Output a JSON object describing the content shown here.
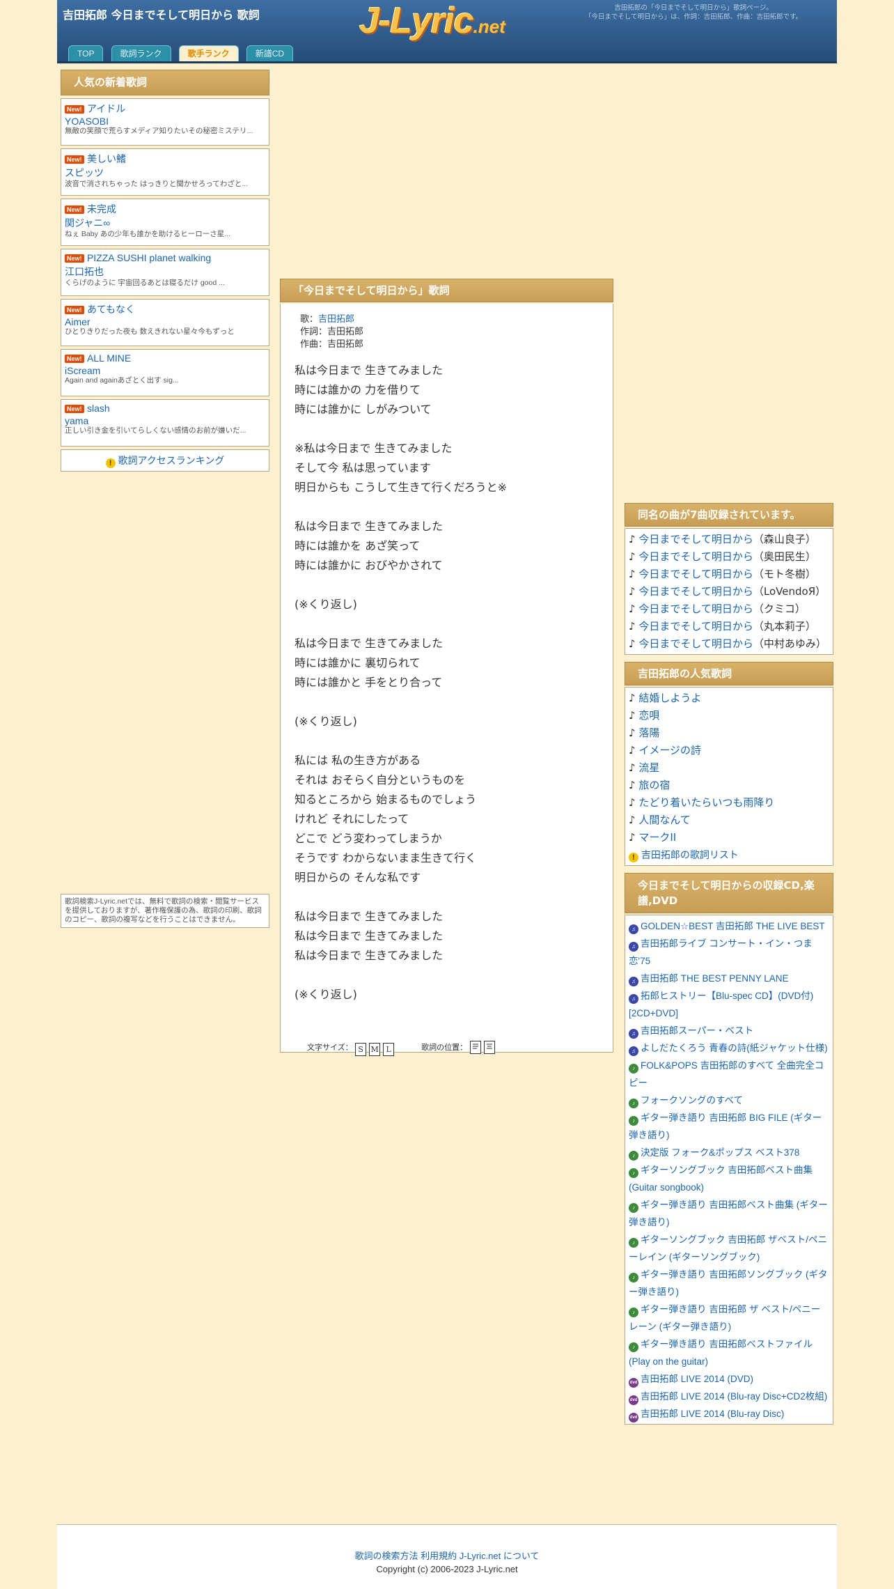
{
  "header": {
    "title": "吉田拓郎 今日までそして明日から 歌詞",
    "logo_main": "J-Lyric",
    "logo_tld": ".net",
    "description_line1": "吉田拓郎の「今日までそして明日から」歌詞ページ。",
    "description_line2": "「今日までそして明日から」は、作詞：吉田拓郎、作曲：吉田拓郎です。"
  },
  "nav": {
    "tabs": [
      {
        "label": "TOP",
        "active": false
      },
      {
        "label": "歌詞ランク",
        "active": false
      },
      {
        "label": "歌手ランク",
        "active": true
      },
      {
        "label": "新譜CD",
        "active": false
      }
    ]
  },
  "left": {
    "heading": "人気の新着歌詞",
    "badge": "New!",
    "items": [
      {
        "title": "アイドル",
        "artist": "YOASOBI",
        "excerpt": "無敵の笑顔で荒らすメディア知りたいその秘密ミステリ..."
      },
      {
        "title": "美しい鰭",
        "artist": "スピッツ",
        "excerpt": "波音で消されちゃった はっきりと聞かせろってわざと..."
      },
      {
        "title": "未完成",
        "artist": "関ジャニ∞",
        "excerpt": "ねぇ Baby あの少年も誰かを助けるヒーローさ星..."
      },
      {
        "title": "PIZZA SUSHI planet walking",
        "artist": "江口拓也",
        "excerpt": "くらげのように 宇宙回るあとは寝るだけ good ..."
      },
      {
        "title": "あてもなく",
        "artist": "Aimer",
        "excerpt": "ひとりきりだった夜も 数えきれない星々今もずっと"
      },
      {
        "title": "ALL MINE",
        "artist": "iScream",
        "excerpt": "Again and againあざとく出す sig..."
      },
      {
        "title": "slash",
        "artist": "yama",
        "excerpt": "正しい引き金を引いてらしくない感情のお前が嫌いだ..."
      }
    ],
    "ranking_link": "歌詞アクセスランキング",
    "disclaimer": "歌詞検索J-Lyric.netでは、無料で歌詞の検索・閲覧サービスを提供しておりますが、著作権保護の為、歌詞の印刷、歌詞のコピー、歌詞の複写などを行うことはできません。"
  },
  "lyric": {
    "heading": "「今日までそして明日から」歌詞",
    "singer_label": "歌：",
    "singer": "吉田拓郎",
    "lyricist_label": "作詞：",
    "lyricist": "吉田拓郎",
    "composer_label": "作曲：",
    "composer": "吉田拓郎",
    "text": "私は今日まで 生きてみました\n時には誰かの 力を借りて\n時には誰かに しがみついて\n\n※私は今日まで 生きてみました\nそして今 私は思っています\n明日からも こうして生きて行くだろうと※\n\n私は今日まで 生きてみました\n時には誰かを あざ笑って\n時には誰かに おびやかされて\n\n(※くり返し)\n\n私は今日まで 生きてみました\n時には誰かに 裏切られて\n時には誰かと 手をとり合って\n\n(※くり返し)\n\n私には 私の生き方がある\nそれは おそらく自分というものを\n知るところから 始まるものでしょう\nけれど それにしたって\nどこで どう変わってしまうか\nそうです わからないまま生きて行く\n明日からの そんな私です\n\n私は今日まで 生きてみました\n私は今日まで 生きてみました\n私は今日まで 生きてみました\n\n(※くり返し)",
    "font_size_label": "文字サイズ：",
    "size_s": "S",
    "size_m": "M",
    "size_l": "L",
    "position_label": "歌詞の位置："
  },
  "right": {
    "same_name": {
      "heading": "同名の曲が7曲収録されています。",
      "items": [
        {
          "title": "今日までそして明日から",
          "artist": "（森山良子）"
        },
        {
          "title": "今日までそして明日から",
          "artist": "（奥田民生）"
        },
        {
          "title": "今日までそして明日から",
          "artist": "（モト冬樹）"
        },
        {
          "title": "今日までそして明日から",
          "artist": "（LoVendoЯ）"
        },
        {
          "title": "今日までそして明日から",
          "artist": "（クミコ）"
        },
        {
          "title": "今日までそして明日から",
          "artist": "（丸本莉子）"
        },
        {
          "title": "今日までそして明日から",
          "artist": "（中村あゆみ）"
        }
      ]
    },
    "popular": {
      "heading": "吉田拓郎の人気歌詞",
      "items": [
        "結婚しようよ",
        "恋唄",
        "落陽",
        "イメージの詩",
        "流星",
        "旅の宿",
        "たどり着いたらいつも雨降り",
        "人間なんて",
        "マークII"
      ],
      "list_link": "吉田拓郎の歌詞リスト"
    },
    "cds": {
      "heading": "今日までそして明日からの収録CD,楽譜,DVD",
      "items": [
        {
          "kind": "music",
          "title": "GOLDEN☆BEST 吉田拓郎 THE LIVE BEST"
        },
        {
          "kind": "music",
          "title": "吉田拓郎ライブ コンサート・イン・つま恋'75"
        },
        {
          "kind": "music",
          "title": "吉田拓郎 THE BEST PENNY LANE"
        },
        {
          "kind": "music",
          "title": "拓郎ヒストリー【Blu-spec CD】(DVD付)[2CD+DVD]"
        },
        {
          "kind": "music",
          "title": "吉田拓郎スーパー・ベスト"
        },
        {
          "kind": "music",
          "title": "よしだたくろう 青春の詩(紙ジャケット仕様)"
        },
        {
          "kind": "book",
          "title": "FOLK&POPS 吉田拓郎のすべて 全曲完全コピー"
        },
        {
          "kind": "book",
          "title": "フォークソングのすべて"
        },
        {
          "kind": "book",
          "title": "ギター弾き語り 吉田拓郎 BIG FILE (ギター弾き語り)"
        },
        {
          "kind": "book",
          "title": "決定版 フォーク&ポップス ベスト378"
        },
        {
          "kind": "book",
          "title": "ギターソングブック 吉田拓郎ベスト曲集 (Guitar songbook)"
        },
        {
          "kind": "book",
          "title": "ギター弾き語り 吉田拓郎ベスト曲集 (ギター弾き語り)"
        },
        {
          "kind": "book",
          "title": "ギターソングブック 吉田拓郎 ザベスト/ペニーレイン (ギターソングブック)"
        },
        {
          "kind": "book",
          "title": "ギター弾き語り 吉田拓郎ソングブック (ギター弾き語り)"
        },
        {
          "kind": "book",
          "title": "ギター弾き語り 吉田拓郎 ザ ベスト/ペニーレーン (ギター弾き語り)"
        },
        {
          "kind": "book",
          "title": "ギター弾き語り 吉田拓郎ベストファイル (Play on the guitar)"
        },
        {
          "kind": "dvd",
          "title": "吉田拓郎 LIVE 2014 (DVD)"
        },
        {
          "kind": "dvd",
          "title": "吉田拓郎 LIVE 2014 (Blu-ray Disc+CD2枚組)"
        },
        {
          "kind": "dvd",
          "title": "吉田拓郎 LIVE 2014 (Blu-ray Disc)"
        }
      ]
    }
  },
  "footer": {
    "link_search": "歌詞の検索方法",
    "link_terms": "利用規約",
    "link_about": "J-Lyric.net について",
    "copyright": "Copyright (c) 2006-2023 J-Lyric.net"
  }
}
